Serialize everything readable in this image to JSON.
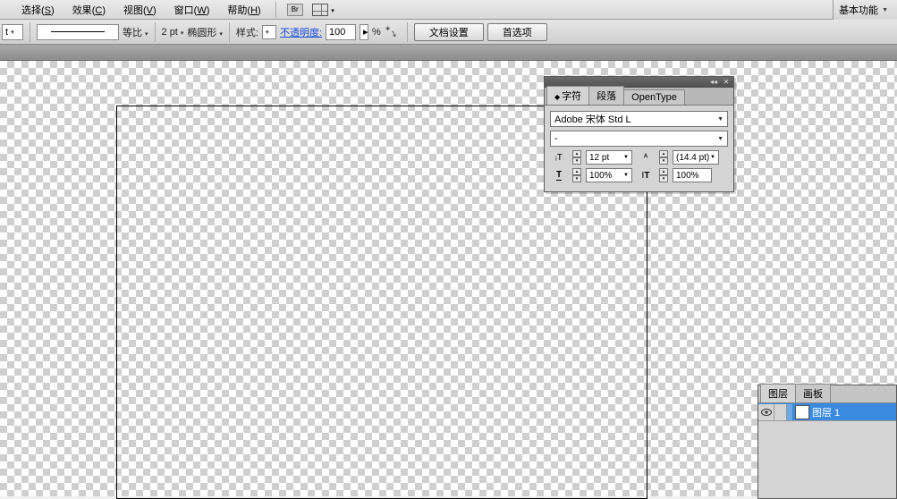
{
  "menu": {
    "select": "选择",
    "select_k": "S",
    "effect": "效果",
    "effect_k": "C",
    "view": "视图",
    "view_k": "V",
    "window": "窗口",
    "window_k": "W",
    "help": "帮助",
    "help_k": "H",
    "br": "Br",
    "workspace": "基本功能"
  },
  "options": {
    "unit_suffix": "t",
    "ratio": "等比",
    "stroke_val": "2 pt",
    "stroke_shape": "椭圆形",
    "style": "样式:",
    "opacity_label": "不透明度:",
    "opacity_val": "100",
    "opacity_unit": "%",
    "btn_doc": "文档设置",
    "btn_pref": "首选项"
  },
  "char": {
    "tab_char": "字符",
    "tab_para": "段落",
    "tab_ot": "OpenType",
    "font": "Adobe 宋体 Std L",
    "style": "-",
    "size": "12 pt",
    "leading": "(14.4 pt)",
    "vscale": "100%",
    "hscale": "100%"
  },
  "layers": {
    "tab_layers": "图层",
    "tab_artboards": "画板",
    "layer1": "图层 1"
  }
}
